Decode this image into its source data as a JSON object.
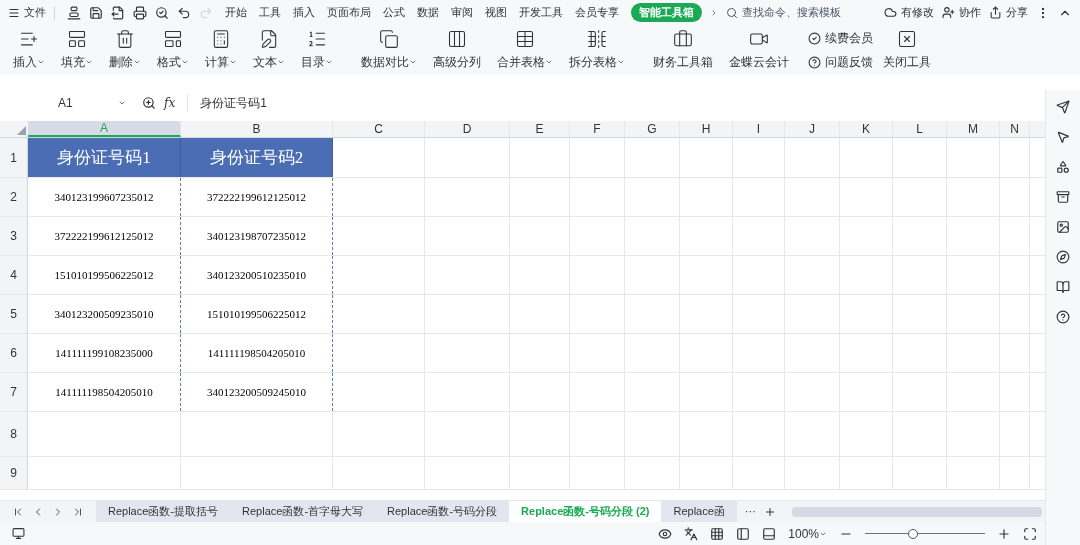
{
  "menu": {
    "file": "文件",
    "tabs": [
      {
        "label": "开始",
        "selected": false
      },
      {
        "label": "工具",
        "selected": false
      },
      {
        "label": "插入",
        "selected": false
      },
      {
        "label": "页面布局",
        "selected": false
      },
      {
        "label": "公式",
        "selected": false
      },
      {
        "label": "数据",
        "selected": false
      },
      {
        "label": "审阅",
        "selected": false
      },
      {
        "label": "视图",
        "selected": false
      },
      {
        "label": "开发工具",
        "selected": false
      },
      {
        "label": "会员专享",
        "selected": false
      },
      {
        "label": "智能工具箱",
        "selected": true
      }
    ],
    "search": {
      "placeholder": "查找命令、搜索模板"
    },
    "actions": [
      "有修改",
      "协作",
      "分享"
    ]
  },
  "ribbon": {
    "buttons": [
      {
        "label": "插入",
        "dropdown": true
      },
      {
        "label": "填充",
        "dropdown": true
      },
      {
        "label": "删除",
        "dropdown": true
      },
      {
        "label": "格式",
        "dropdown": true
      },
      {
        "label": "计算",
        "dropdown": true
      },
      {
        "label": "文本",
        "dropdown": true
      },
      {
        "label": "目录",
        "dropdown": true
      },
      {
        "label": "数据对比",
        "dropdown": true
      },
      {
        "label": "高级分列",
        "dropdown": false
      },
      {
        "label": "合并表格",
        "dropdown": true
      },
      {
        "label": "拆分表格",
        "dropdown": true
      },
      {
        "label": "财务工具箱",
        "dropdown": false
      },
      {
        "label": "金蝶云会计",
        "dropdown": false
      }
    ],
    "small": [
      "续费会员",
      "问题反馈"
    ],
    "close": "关闭工具"
  },
  "formula_bar": {
    "cell_ref": "A1",
    "fx": "fx",
    "value": "身份证号码1"
  },
  "columns": [
    {
      "label": "A",
      "selected": true
    },
    {
      "label": "B",
      "selected": false
    },
    {
      "label": "C",
      "selected": false
    },
    {
      "label": "D",
      "selected": false
    },
    {
      "label": "E",
      "selected": false
    },
    {
      "label": "F",
      "selected": false
    },
    {
      "label": "G",
      "selected": false
    },
    {
      "label": "H",
      "selected": false
    },
    {
      "label": "I",
      "selected": false
    },
    {
      "label": "J",
      "selected": false
    },
    {
      "label": "K",
      "selected": false
    },
    {
      "label": "L",
      "selected": false
    },
    {
      "label": "M",
      "selected": false
    },
    {
      "label": "N",
      "selected": false
    }
  ],
  "rows": [
    {
      "number": "1",
      "cells": [
        "身份证号码1",
        "身份证号码2"
      ]
    },
    {
      "number": "2",
      "cells": [
        "340123199607235012",
        "372222199612125012"
      ]
    },
    {
      "number": "3",
      "cells": [
        "372222199612125012",
        "340123198707235012"
      ]
    },
    {
      "number": "4",
      "cells": [
        "151010199506225012",
        "340123200510235010"
      ]
    },
    {
      "number": "5",
      "cells": [
        "340123200509235010",
        "151010199506225012"
      ]
    },
    {
      "number": "6",
      "cells": [
        "141111199108235000",
        "141111198504205010"
      ]
    },
    {
      "number": "7",
      "cells": [
        "141111198504205010",
        "340123200509245010"
      ]
    },
    {
      "number": "8",
      "cells": []
    },
    {
      "number": "9",
      "cells": []
    }
  ],
  "sheet_tabs": [
    {
      "label": "Replace函数-提取括号",
      "selected": false
    },
    {
      "label": "Replace函数-首字母大写",
      "selected": false
    },
    {
      "label": "Replace函数-号码分段",
      "selected": false
    },
    {
      "label": "Replace函数-号码分段 (2)",
      "selected": true
    },
    {
      "label": "Replace函",
      "selected": false
    }
  ],
  "sheet_more": "···",
  "status": {
    "zoom": "100%",
    "zoom_slider": {
      "level": 0.4
    }
  }
}
